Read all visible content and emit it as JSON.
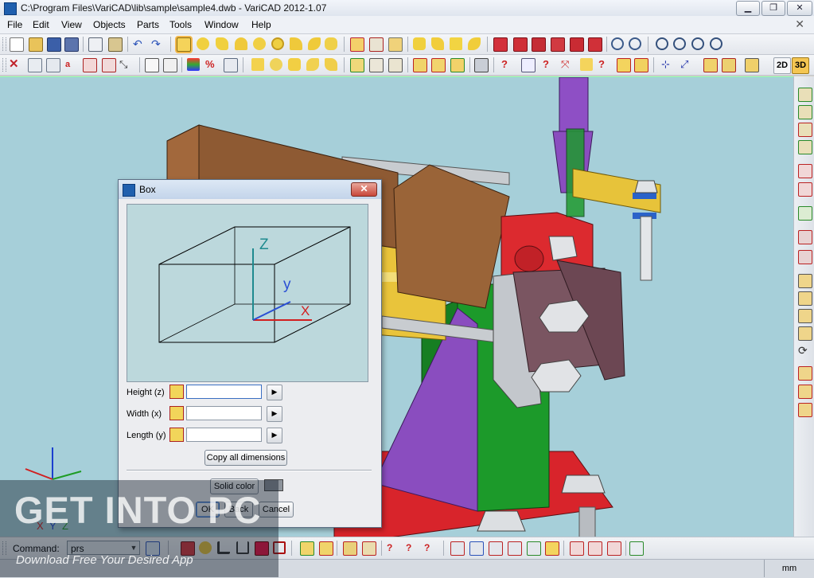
{
  "window": {
    "title": "C:\\Program Files\\VariCAD\\lib\\sample\\sample4.dwb - VariCAD 2012-1.07",
    "controls": {
      "minimize": "▁",
      "maximize": "❐",
      "close": "✕"
    },
    "mdi_close": "✕"
  },
  "menu": {
    "items": [
      "File",
      "Edit",
      "View",
      "Objects",
      "Parts",
      "Tools",
      "Window",
      "Help"
    ]
  },
  "view_toggle": {
    "label_2d": "2D",
    "label_3d": "3D"
  },
  "dialog": {
    "title": "Box",
    "close_glyph": "✕",
    "preview": {
      "axis_z": "Z",
      "axis_y": "y",
      "axis_x": "X"
    },
    "fields": [
      {
        "label": "Height (z)",
        "value": "",
        "icon": "height-dimension-icon"
      },
      {
        "label": "Width (x)",
        "value": "",
        "icon": "width-dimension-icon"
      },
      {
        "label": "Length (y)",
        "value": "",
        "icon": "length-dimension-icon"
      }
    ],
    "arrow_glyph": "▶",
    "copy_all_label": "Copy all dimensions",
    "solid_color_label": "Solid color",
    "solid_color_value": "#8d939b",
    "ok_label": "OK",
    "back_label": "Back",
    "cancel_label": "Cancel"
  },
  "viewport": {
    "background": "#a6cfd9",
    "axis_labels": {
      "x": "X",
      "y": "Y",
      "z": "Z"
    }
  },
  "command": {
    "label": "Command:",
    "value": "prs",
    "dropdown_glyph": "▼"
  },
  "status": {
    "units": "mm"
  },
  "watermark": {
    "title": "GET INTO PC",
    "subtitle": "Download Free Your Desired App"
  }
}
